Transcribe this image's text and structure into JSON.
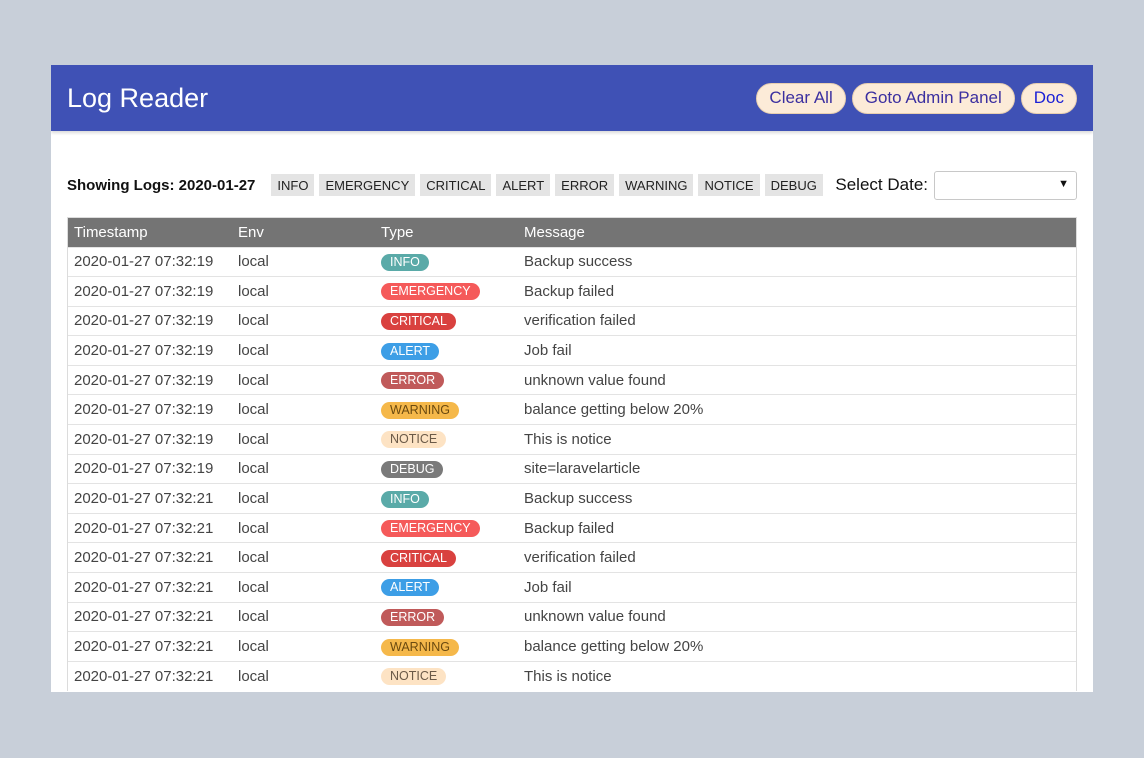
{
  "header": {
    "title": "Log Reader",
    "buttons": {
      "clear_all": "Clear All",
      "admin_panel": "Goto Admin Panel",
      "doc": "Doc"
    }
  },
  "toolbar": {
    "showing_label": "Showing Logs: 2020-01-27",
    "filters": [
      "INFO",
      "EMERGENCY",
      "CRITICAL",
      "ALERT",
      "ERROR",
      "WARNING",
      "NOTICE",
      "DEBUG"
    ],
    "date_label": "Select Date:",
    "date_value": ""
  },
  "table": {
    "columns": [
      "Timestamp",
      "Env",
      "Type",
      "Message"
    ],
    "rows": [
      {
        "timestamp": "2020-01-27 07:32:19",
        "env": "local",
        "type": "INFO",
        "message": "Backup success"
      },
      {
        "timestamp": "2020-01-27 07:32:19",
        "env": "local",
        "type": "EMERGENCY",
        "message": "Backup failed"
      },
      {
        "timestamp": "2020-01-27 07:32:19",
        "env": "local",
        "type": "CRITICAL",
        "message": "verification failed"
      },
      {
        "timestamp": "2020-01-27 07:32:19",
        "env": "local",
        "type": "ALERT",
        "message": "Job fail"
      },
      {
        "timestamp": "2020-01-27 07:32:19",
        "env": "local",
        "type": "ERROR",
        "message": "unknown value found"
      },
      {
        "timestamp": "2020-01-27 07:32:19",
        "env": "local",
        "type": "WARNING",
        "message": "balance getting below 20%"
      },
      {
        "timestamp": "2020-01-27 07:32:19",
        "env": "local",
        "type": "NOTICE",
        "message": "This is notice"
      },
      {
        "timestamp": "2020-01-27 07:32:19",
        "env": "local",
        "type": "DEBUG",
        "message": "site=laravelarticle"
      },
      {
        "timestamp": "2020-01-27 07:32:21",
        "env": "local",
        "type": "INFO",
        "message": "Backup success"
      },
      {
        "timestamp": "2020-01-27 07:32:21",
        "env": "local",
        "type": "EMERGENCY",
        "message": "Backup failed"
      },
      {
        "timestamp": "2020-01-27 07:32:21",
        "env": "local",
        "type": "CRITICAL",
        "message": "verification failed"
      },
      {
        "timestamp": "2020-01-27 07:32:21",
        "env": "local",
        "type": "ALERT",
        "message": "Job fail"
      },
      {
        "timestamp": "2020-01-27 07:32:21",
        "env": "local",
        "type": "ERROR",
        "message": "unknown value found"
      },
      {
        "timestamp": "2020-01-27 07:32:21",
        "env": "local",
        "type": "WARNING",
        "message": "balance getting below 20%"
      },
      {
        "timestamp": "2020-01-27 07:32:21",
        "env": "local",
        "type": "NOTICE",
        "message": "This is notice"
      }
    ]
  },
  "colors": {
    "header_bg": "#3f51b5",
    "page_bg": "#c8cfd9",
    "badges": {
      "INFO": {
        "bg": "#5aaaa8",
        "fg": "#ffffff"
      },
      "EMERGENCY": {
        "bg": "#f55a5a",
        "fg": "#ffffff"
      },
      "CRITICAL": {
        "bg": "#d9413f",
        "fg": "#ffffff"
      },
      "ALERT": {
        "bg": "#3d9ee6",
        "fg": "#ffffff"
      },
      "ERROR": {
        "bg": "#c05a5a",
        "fg": "#ffffff"
      },
      "WARNING": {
        "bg": "#f5b84a",
        "fg": "#6b4a10"
      },
      "NOTICE": {
        "bg": "#fde3c4",
        "fg": "#6b5a48"
      },
      "DEBUG": {
        "bg": "#7a7a7a",
        "fg": "#ffffff"
      }
    }
  },
  "icons": {
    "date_caret": "caret-down-icon"
  }
}
